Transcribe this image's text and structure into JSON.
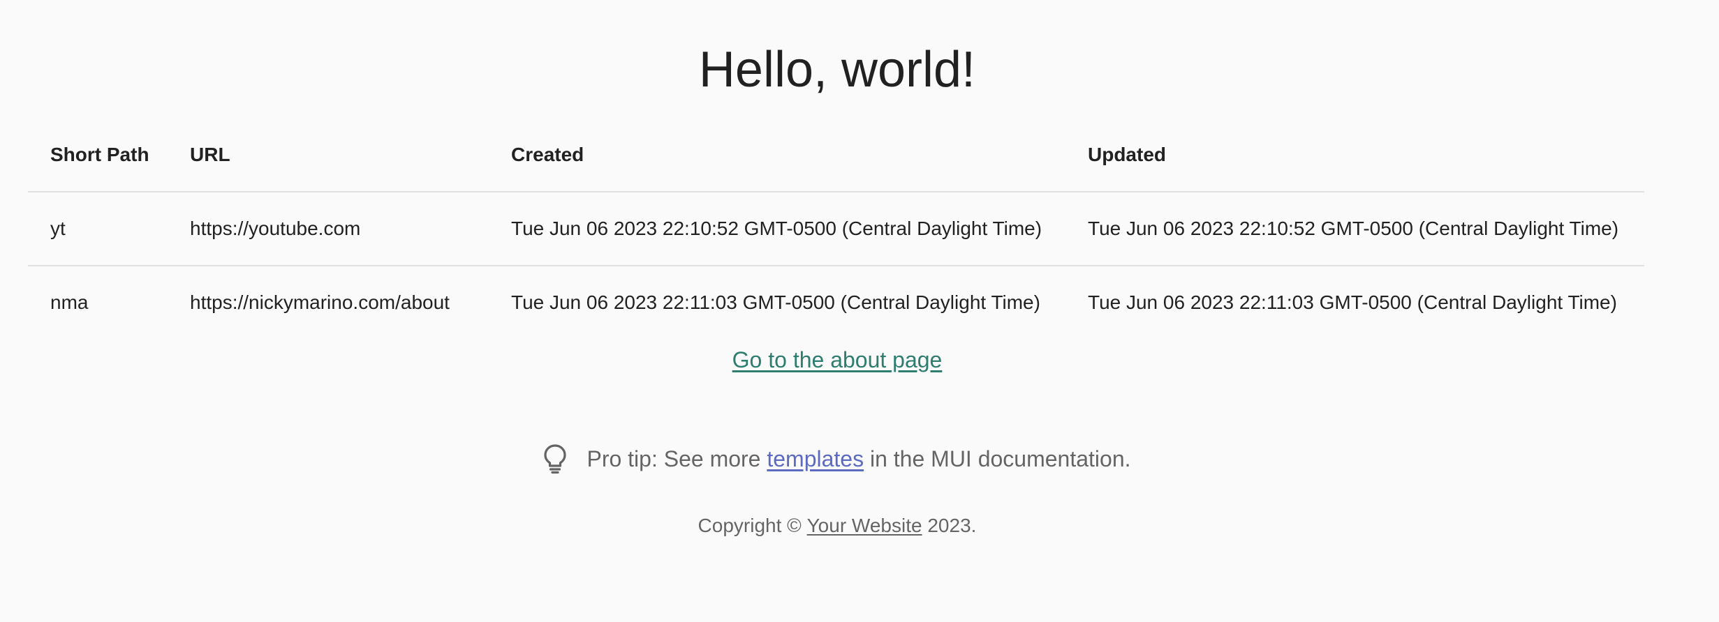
{
  "page": {
    "title": "Hello, world!"
  },
  "table": {
    "headers": {
      "short_path": "Short Path",
      "url": "URL",
      "created": "Created",
      "updated": "Updated"
    },
    "rows": [
      {
        "short_path": "yt",
        "url": "https://youtube.com",
        "created": "Tue Jun 06 2023 22:10:52 GMT-0500 (Central Daylight Time)",
        "updated": "Tue Jun 06 2023 22:10:52 GMT-0500 (Central Daylight Time)"
      },
      {
        "short_path": "nma",
        "url": "https://nickymarino.com/about",
        "created": "Tue Jun 06 2023 22:11:03 GMT-0500 (Central Daylight Time)",
        "updated": "Tue Jun 06 2023 22:11:03 GMT-0500 (Central Daylight Time)"
      }
    ]
  },
  "about_link": {
    "label": "Go to the about page",
    "color": "#2e7d6f"
  },
  "protip": {
    "icon": "lightbulb-icon",
    "prefix": "Pro tip: See more",
    "link_label": "templates",
    "suffix": "in the MUI documentation.",
    "link_color": "#5c6bc0"
  },
  "footer": {
    "prefix": "Copyright ©",
    "link_label": "Your Website",
    "year_suffix": "2023."
  }
}
